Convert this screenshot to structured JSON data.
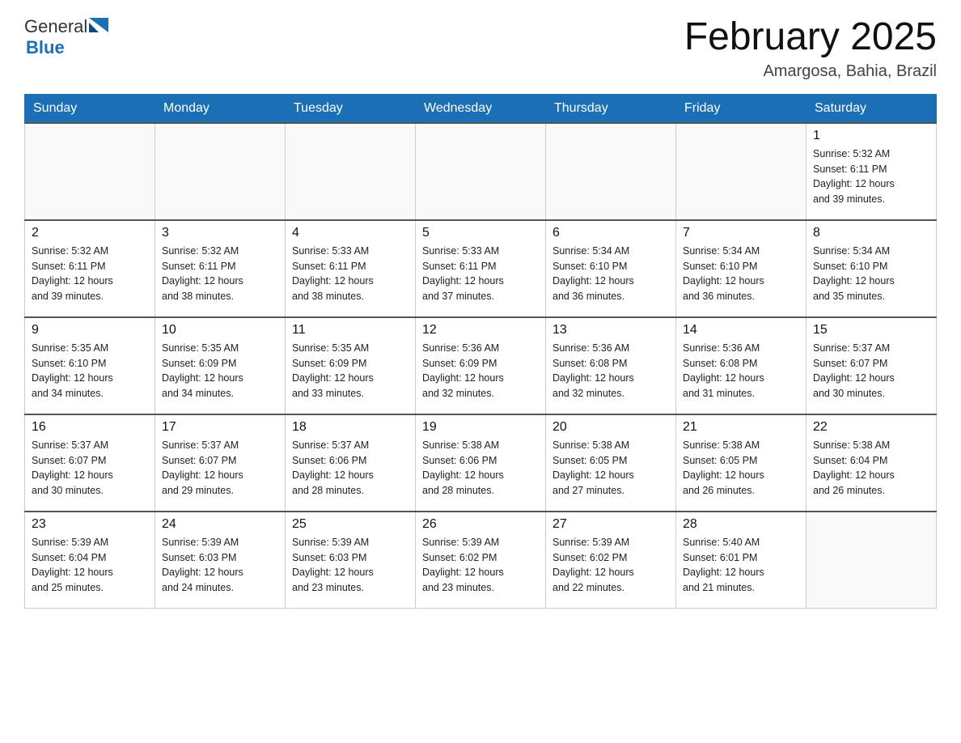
{
  "header": {
    "logo_general": "General",
    "logo_blue": "Blue",
    "month_year": "February 2025",
    "location": "Amargosa, Bahia, Brazil"
  },
  "days_of_week": [
    "Sunday",
    "Monday",
    "Tuesday",
    "Wednesday",
    "Thursday",
    "Friday",
    "Saturday"
  ],
  "weeks": [
    [
      {
        "day": "",
        "info": ""
      },
      {
        "day": "",
        "info": ""
      },
      {
        "day": "",
        "info": ""
      },
      {
        "day": "",
        "info": ""
      },
      {
        "day": "",
        "info": ""
      },
      {
        "day": "",
        "info": ""
      },
      {
        "day": "1",
        "info": "Sunrise: 5:32 AM\nSunset: 6:11 PM\nDaylight: 12 hours\nand 39 minutes."
      }
    ],
    [
      {
        "day": "2",
        "info": "Sunrise: 5:32 AM\nSunset: 6:11 PM\nDaylight: 12 hours\nand 39 minutes."
      },
      {
        "day": "3",
        "info": "Sunrise: 5:32 AM\nSunset: 6:11 PM\nDaylight: 12 hours\nand 38 minutes."
      },
      {
        "day": "4",
        "info": "Sunrise: 5:33 AM\nSunset: 6:11 PM\nDaylight: 12 hours\nand 38 minutes."
      },
      {
        "day": "5",
        "info": "Sunrise: 5:33 AM\nSunset: 6:11 PM\nDaylight: 12 hours\nand 37 minutes."
      },
      {
        "day": "6",
        "info": "Sunrise: 5:34 AM\nSunset: 6:10 PM\nDaylight: 12 hours\nand 36 minutes."
      },
      {
        "day": "7",
        "info": "Sunrise: 5:34 AM\nSunset: 6:10 PM\nDaylight: 12 hours\nand 36 minutes."
      },
      {
        "day": "8",
        "info": "Sunrise: 5:34 AM\nSunset: 6:10 PM\nDaylight: 12 hours\nand 35 minutes."
      }
    ],
    [
      {
        "day": "9",
        "info": "Sunrise: 5:35 AM\nSunset: 6:10 PM\nDaylight: 12 hours\nand 34 minutes."
      },
      {
        "day": "10",
        "info": "Sunrise: 5:35 AM\nSunset: 6:09 PM\nDaylight: 12 hours\nand 34 minutes."
      },
      {
        "day": "11",
        "info": "Sunrise: 5:35 AM\nSunset: 6:09 PM\nDaylight: 12 hours\nand 33 minutes."
      },
      {
        "day": "12",
        "info": "Sunrise: 5:36 AM\nSunset: 6:09 PM\nDaylight: 12 hours\nand 32 minutes."
      },
      {
        "day": "13",
        "info": "Sunrise: 5:36 AM\nSunset: 6:08 PM\nDaylight: 12 hours\nand 32 minutes."
      },
      {
        "day": "14",
        "info": "Sunrise: 5:36 AM\nSunset: 6:08 PM\nDaylight: 12 hours\nand 31 minutes."
      },
      {
        "day": "15",
        "info": "Sunrise: 5:37 AM\nSunset: 6:07 PM\nDaylight: 12 hours\nand 30 minutes."
      }
    ],
    [
      {
        "day": "16",
        "info": "Sunrise: 5:37 AM\nSunset: 6:07 PM\nDaylight: 12 hours\nand 30 minutes."
      },
      {
        "day": "17",
        "info": "Sunrise: 5:37 AM\nSunset: 6:07 PM\nDaylight: 12 hours\nand 29 minutes."
      },
      {
        "day": "18",
        "info": "Sunrise: 5:37 AM\nSunset: 6:06 PM\nDaylight: 12 hours\nand 28 minutes."
      },
      {
        "day": "19",
        "info": "Sunrise: 5:38 AM\nSunset: 6:06 PM\nDaylight: 12 hours\nand 28 minutes."
      },
      {
        "day": "20",
        "info": "Sunrise: 5:38 AM\nSunset: 6:05 PM\nDaylight: 12 hours\nand 27 minutes."
      },
      {
        "day": "21",
        "info": "Sunrise: 5:38 AM\nSunset: 6:05 PM\nDaylight: 12 hours\nand 26 minutes."
      },
      {
        "day": "22",
        "info": "Sunrise: 5:38 AM\nSunset: 6:04 PM\nDaylight: 12 hours\nand 26 minutes."
      }
    ],
    [
      {
        "day": "23",
        "info": "Sunrise: 5:39 AM\nSunset: 6:04 PM\nDaylight: 12 hours\nand 25 minutes."
      },
      {
        "day": "24",
        "info": "Sunrise: 5:39 AM\nSunset: 6:03 PM\nDaylight: 12 hours\nand 24 minutes."
      },
      {
        "day": "25",
        "info": "Sunrise: 5:39 AM\nSunset: 6:03 PM\nDaylight: 12 hours\nand 23 minutes."
      },
      {
        "day": "26",
        "info": "Sunrise: 5:39 AM\nSunset: 6:02 PM\nDaylight: 12 hours\nand 23 minutes."
      },
      {
        "day": "27",
        "info": "Sunrise: 5:39 AM\nSunset: 6:02 PM\nDaylight: 12 hours\nand 22 minutes."
      },
      {
        "day": "28",
        "info": "Sunrise: 5:40 AM\nSunset: 6:01 PM\nDaylight: 12 hours\nand 21 minutes."
      },
      {
        "day": "",
        "info": ""
      }
    ]
  ]
}
